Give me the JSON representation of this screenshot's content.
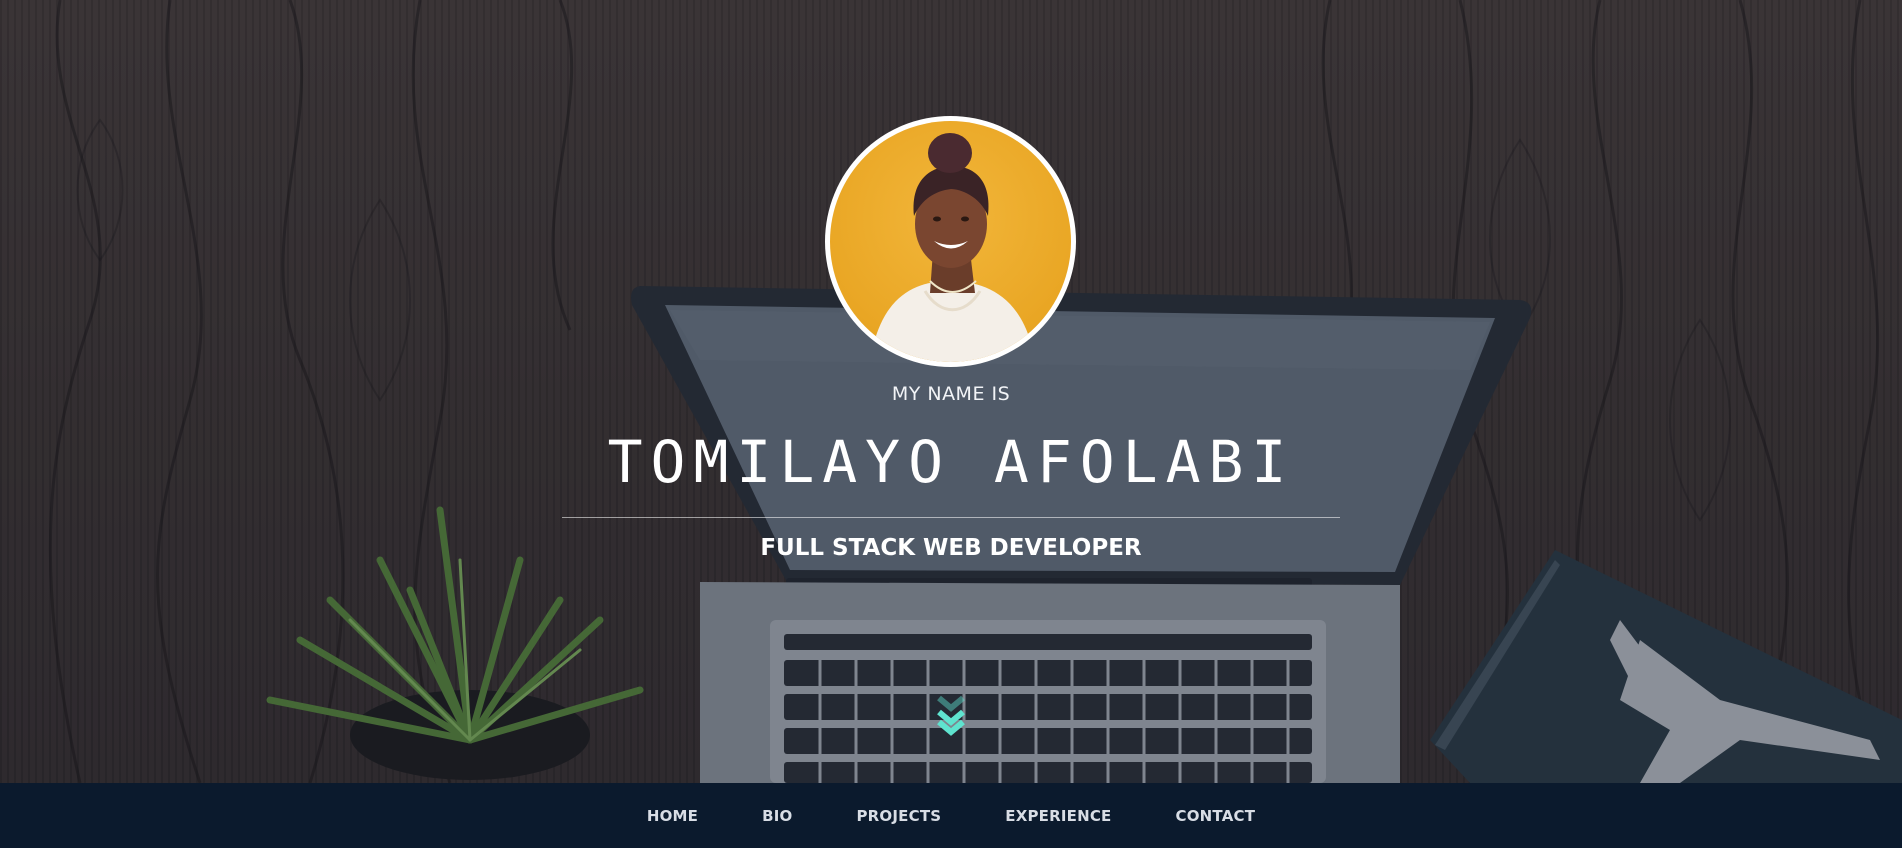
{
  "hero": {
    "eyebrow": "MY NAME IS",
    "name": "TOMILAYO AFOLABI",
    "role": "FULL STACK WEB DEVELOPER",
    "scroll_icon": "double-chevron-down-icon"
  },
  "nav": {
    "items": [
      {
        "label": "HOME"
      },
      {
        "label": "BIO"
      },
      {
        "label": "PROJECTS"
      },
      {
        "label": "EXPERIENCE"
      },
      {
        "label": "CONTACT"
      }
    ]
  },
  "colors": {
    "navbar_bg": "#0b1a2d",
    "accent": "#5fe3cf",
    "avatar_bg": "#e9a624"
  }
}
